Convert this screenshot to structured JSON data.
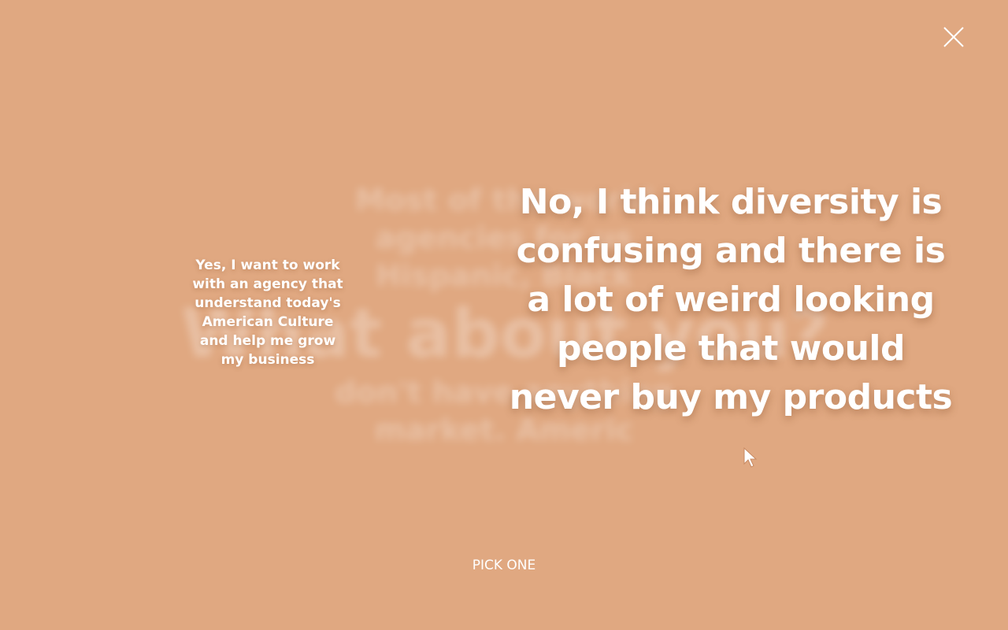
{
  "background": {
    "color": "#e0a881",
    "blurred_lines_top": [
      "Most of the world",
      "agencies for us",
      "Hispanic, Black"
    ],
    "blurred_heading": "What about you?",
    "blurred_lines_bottom": [
      "don't have anything",
      "market. Americ"
    ]
  },
  "close": {
    "icon": "close-icon"
  },
  "choices": {
    "left_text": "Yes, I want to work with an agency that understand today's American Culture and help me grow my business",
    "right_text": "No, I think diversity is confusing and there is a lot of weird looking people that would never buy my products"
  },
  "footer": {
    "pick_label": "PICK ONE"
  },
  "cursor": {
    "icon": "pointer-arrow-icon"
  }
}
